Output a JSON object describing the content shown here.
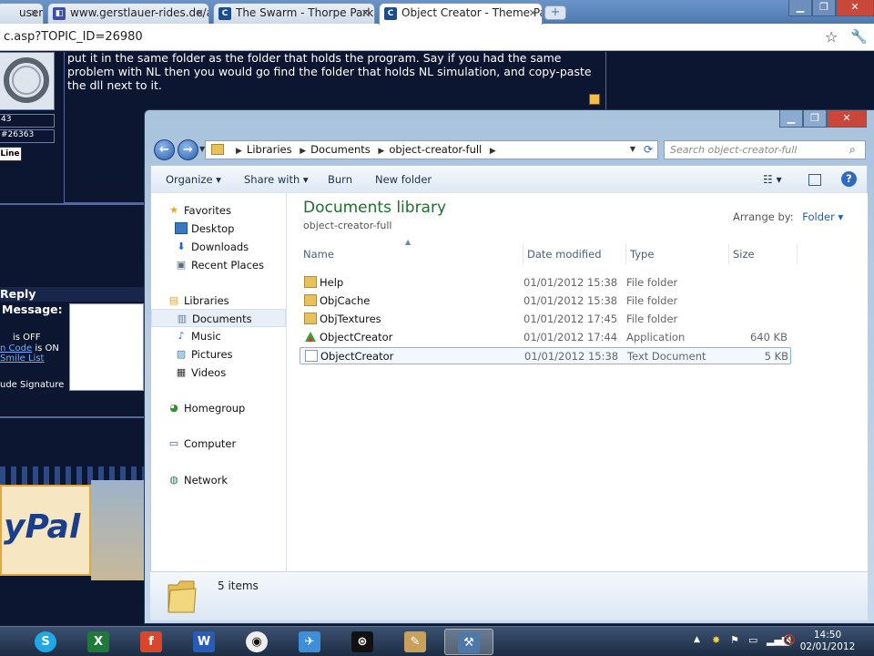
{
  "browser": {
    "tabs": [
      {
        "label": "usem",
        "icon": "page-icon"
      },
      {
        "label": "www.gerstlauer-rides.de/as",
        "icon": "page-icon"
      },
      {
        "label": "The Swarm - Thorpe Park",
        "icon": "coaster-site-icon"
      },
      {
        "label": "Object Creator - Theme Par",
        "icon": "coaster-site-icon",
        "active": true
      }
    ],
    "url": "c.asp?TOPIC_ID=26980"
  },
  "forum": {
    "post_text": "put it in the same folder as the folder that holds the program. Say if you had the same problem with NL then you would go find the folder that holds NL simulation, and copy-paste the dll next to it.",
    "side_count": "43",
    "side_id": "#26363",
    "online_badge": "Line",
    "reply_heading": "Reply",
    "message_label": "Message:",
    "html_status": "is OFF",
    "code_link": "n Code",
    "code_status": "is ON",
    "smile_link": "Smile List",
    "signature_label": "ude Signature",
    "paypal_text": "yPal"
  },
  "explorer": {
    "breadcrumb": [
      "Libraries",
      "Documents",
      "object-creator-full"
    ],
    "search_placeholder": "Search object-creator-full",
    "commands": {
      "organize": "Organize",
      "share_with": "Share with",
      "burn": "Burn",
      "new_folder": "New folder"
    },
    "nav": {
      "favorites": "Favorites",
      "desktop": "Desktop",
      "downloads": "Downloads",
      "recent_places": "Recent Places",
      "libraries": "Libraries",
      "documents": "Documents",
      "music": "Music",
      "pictures": "Pictures",
      "videos": "Videos",
      "homegroup": "Homegroup",
      "computer": "Computer",
      "network": "Network"
    },
    "library_title": "Documents library",
    "library_subtitle": "object-creator-full",
    "arrange_label": "Arrange by:",
    "arrange_value": "Folder",
    "columns": {
      "name": "Name",
      "date": "Date modified",
      "type": "Type",
      "size": "Size"
    },
    "files": [
      {
        "name": "Help",
        "date": "01/01/2012 15:38",
        "type": "File folder",
        "size": "",
        "icon": "folder-icon"
      },
      {
        "name": "ObjCache",
        "date": "01/01/2012 15:38",
        "type": "File folder",
        "size": "",
        "icon": "folder-icon"
      },
      {
        "name": "ObjTextures",
        "date": "01/01/2012 17:45",
        "type": "File folder",
        "size": "",
        "icon": "folder-icon"
      },
      {
        "name": "ObjectCreator",
        "date": "01/01/2012 17:44",
        "type": "Application",
        "size": "640 KB",
        "icon": "application-icon"
      },
      {
        "name": "ObjectCreator",
        "date": "01/01/2012 15:38",
        "type": "Text Document",
        "size": "5 KB",
        "icon": "text-document-icon"
      }
    ],
    "details_count": "5 items"
  },
  "taskbar": {
    "clock_time": "14:50",
    "clock_date": "02/01/2012"
  },
  "colors": {
    "forum_bg": "#0c1630",
    "library_title": "#1e6e2d",
    "link_blue": "#1e5fb3",
    "taskbar": "#2a3d58"
  }
}
